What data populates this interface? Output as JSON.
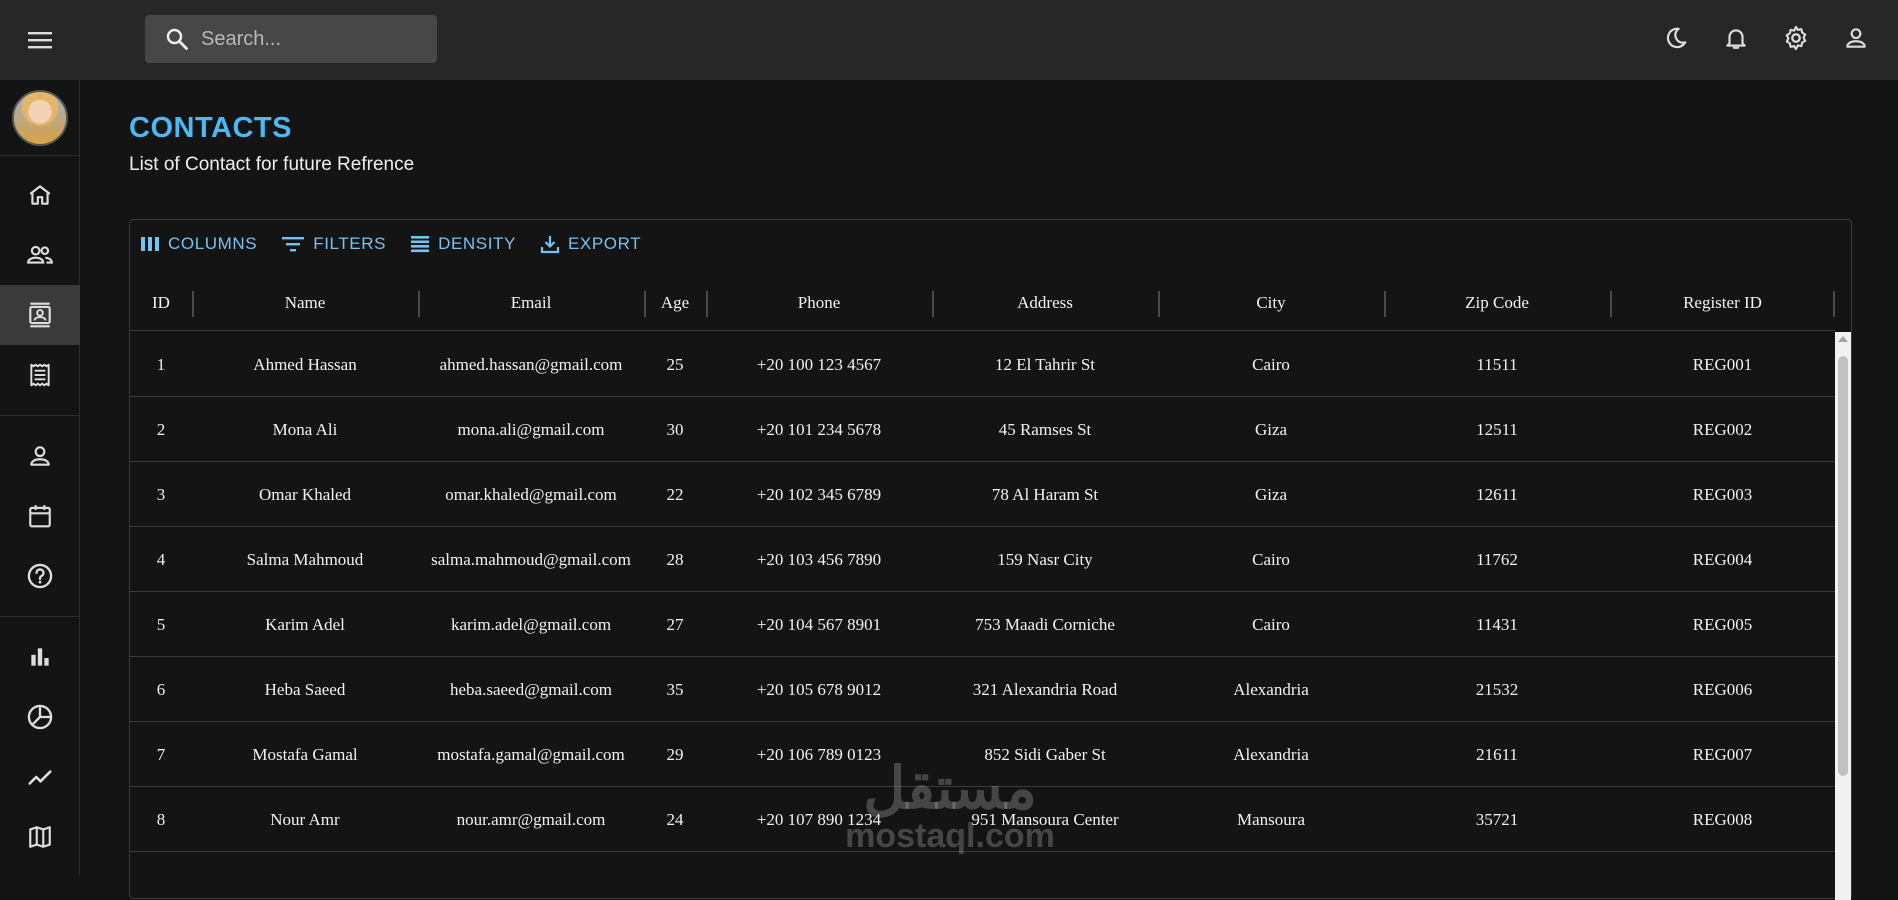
{
  "search": {
    "placeholder": "Search..."
  },
  "header": {
    "title": "CONTACTS",
    "subtitle": "List of Contact for future Refrence"
  },
  "toolbar": [
    {
      "label": "COLUMNS",
      "icon": "columns-icon"
    },
    {
      "label": "FILTERS",
      "icon": "filter-icon"
    },
    {
      "label": "DENSITY",
      "icon": "density-icon"
    },
    {
      "label": "EXPORT",
      "icon": "export-icon"
    }
  ],
  "columns": [
    "ID",
    "Name",
    "Email",
    "Age",
    "Phone",
    "Address",
    "City",
    "Zip Code",
    "Register ID"
  ],
  "rows": [
    [
      "1",
      "Ahmed Hassan",
      "ahmed.hassan@gmail.com",
      "25",
      "+20 100 123 4567",
      "12 El Tahrir St",
      "Cairo",
      "11511",
      "REG001"
    ],
    [
      "2",
      "Mona Ali",
      "mona.ali@gmail.com",
      "30",
      "+20 101 234 5678",
      "45 Ramses St",
      "Giza",
      "12511",
      "REG002"
    ],
    [
      "3",
      "Omar Khaled",
      "omar.khaled@gmail.com",
      "22",
      "+20 102 345 6789",
      "78 Al Haram St",
      "Giza",
      "12611",
      "REG003"
    ],
    [
      "4",
      "Salma Mahmoud",
      "salma.mahmoud@gmail.com",
      "28",
      "+20 103 456 7890",
      "159 Nasr City",
      "Cairo",
      "11762",
      "REG004"
    ],
    [
      "5",
      "Karim Adel",
      "karim.adel@gmail.com",
      "27",
      "+20 104 567 8901",
      "753 Maadi Corniche",
      "Cairo",
      "11431",
      "REG005"
    ],
    [
      "6",
      "Heba Saeed",
      "heba.saeed@gmail.com",
      "35",
      "+20 105 678 9012",
      "321 Alexandria Road",
      "Alexandria",
      "21532",
      "REG006"
    ],
    [
      "7",
      "Mostafa Gamal",
      "mostafa.gamal@gmail.com",
      "29",
      "+20 106 789 0123",
      "852 Sidi Gaber St",
      "Alexandria",
      "21611",
      "REG007"
    ],
    [
      "8",
      "Nour Amr",
      "nour.amr@gmail.com",
      "24",
      "+20 107 890 1234",
      "951 Mansoura Center",
      "Mansoura",
      "35721",
      "REG008"
    ]
  ],
  "watermark": {
    "arabic": "مستقل",
    "latin": "mostaql.com"
  },
  "colors": {
    "accent": "#4cb8f5",
    "toolbar": "#78c2f2",
    "topbar": "#272727",
    "background": "#141414"
  }
}
